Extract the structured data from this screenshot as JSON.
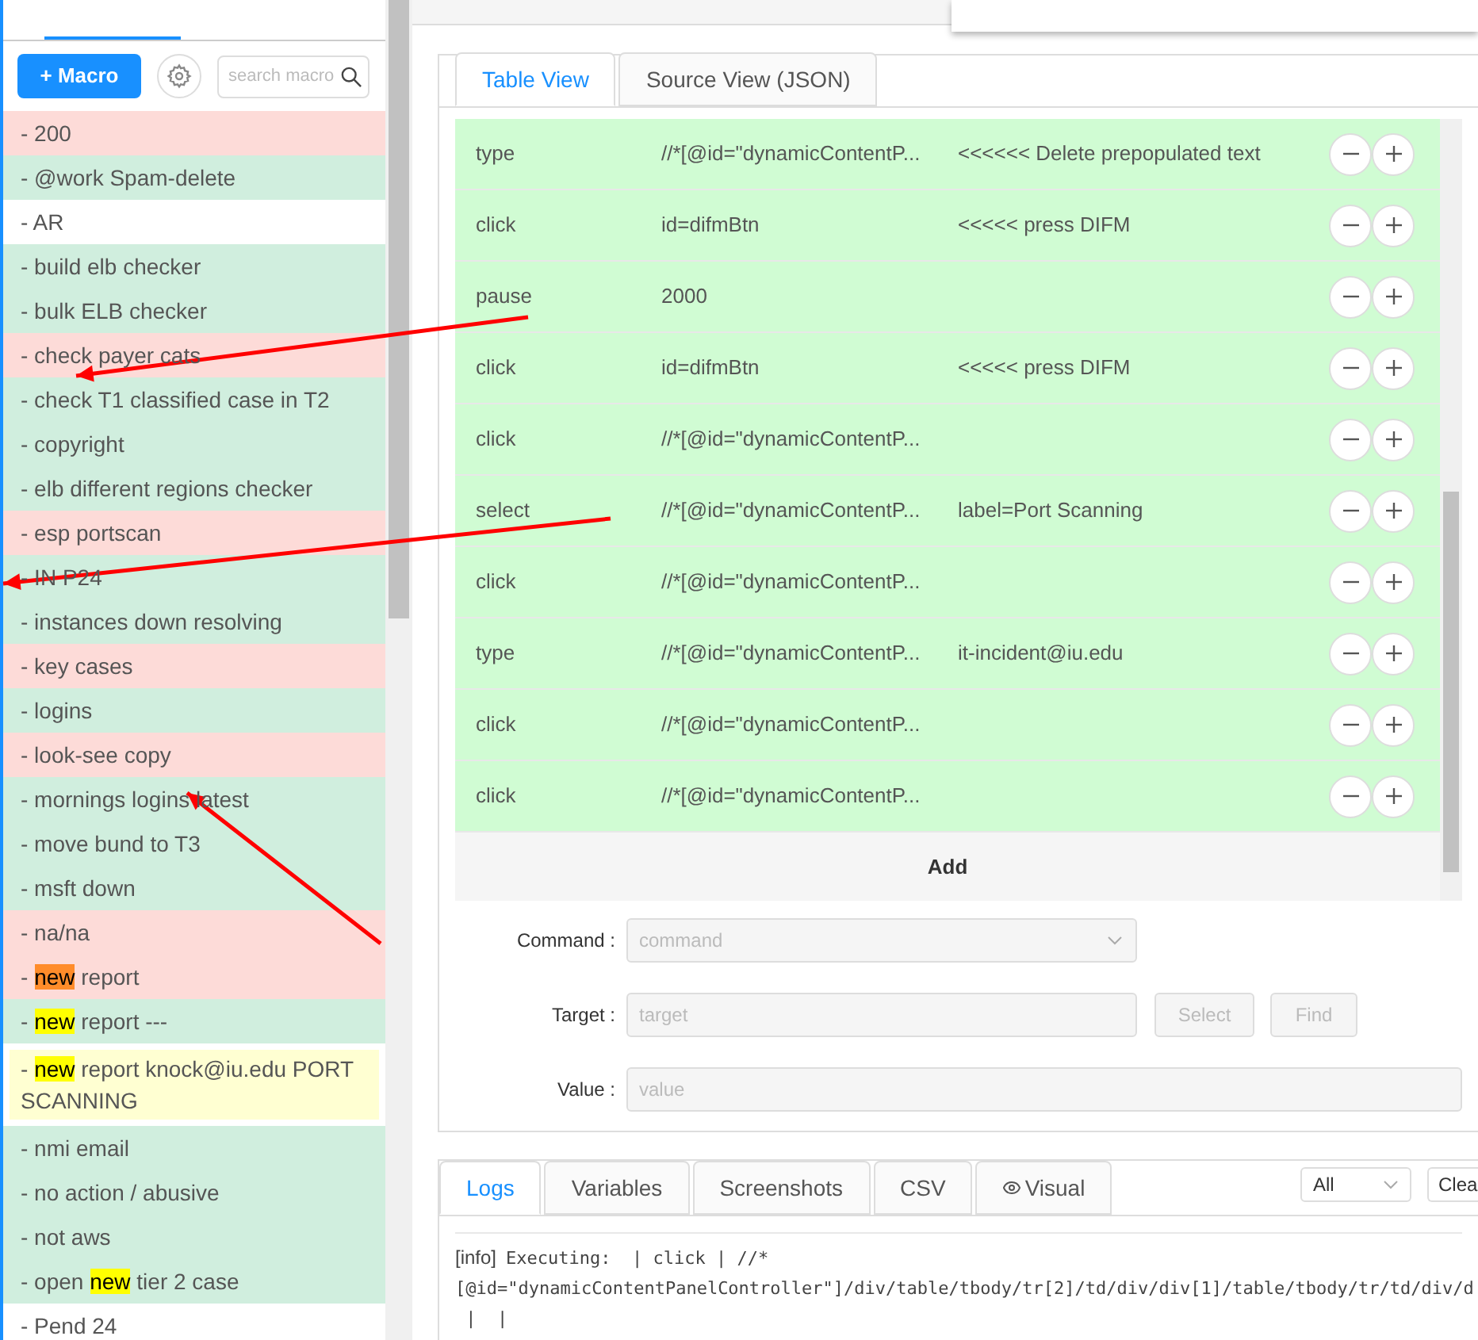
{
  "sidebar": {
    "new_macro_button": "+ Macro",
    "search": {
      "placeholder": "search macro"
    },
    "items": [
      {
        "text": "- 200",
        "color": "#fddbd8"
      },
      {
        "text": "- @work Spam-delete",
        "color": "#d0eede"
      },
      {
        "text": "- AR",
        "color": "#ffffff"
      },
      {
        "text": "- build elb checker",
        "color": "#d0eede"
      },
      {
        "text": "- bulk ELB checker",
        "color": "#d0eede"
      },
      {
        "text": "- check payer cats",
        "color": "#fddbd8"
      },
      {
        "text": "- check T1 classified case in T2",
        "color": "#d0eede"
      },
      {
        "text": "- copyright",
        "color": "#d0eede"
      },
      {
        "text": "- elb different regions checker",
        "color": "#d0eede"
      },
      {
        "text": "- esp portscan",
        "color": "#fddbd8"
      },
      {
        "text": "- IN P24",
        "color": "#d0eede"
      },
      {
        "text": "- instances down resolving",
        "color": "#d0eede"
      },
      {
        "text": "- key cases",
        "color": "#fddbd8"
      },
      {
        "text": "- logins",
        "color": "#d0eede"
      },
      {
        "text": "- look-see copy",
        "color": "#fddbd8"
      },
      {
        "text": "- mornings logins latest",
        "color": "#d0eede"
      },
      {
        "text": "- move bund to T3",
        "color": "#d0eede"
      },
      {
        "text": "- msft down",
        "color": "#d0eede"
      },
      {
        "text": "- na/na",
        "color": "#fddbd8"
      },
      {
        "text": "- ",
        "match": "new",
        "match_current": true,
        "rest": " report",
        "color": "#fddbd8"
      },
      {
        "text": "- ",
        "match": "new",
        "match_current": false,
        "rest": " report ---",
        "color": "#d0eede"
      },
      {
        "text": "- ",
        "match": "new",
        "match_current": false,
        "rest": " report knock@iu.edu PORT SCANNING",
        "color": "#ffffd2",
        "selected": true
      },
      {
        "text": "- nmi email",
        "color": "#d0eede"
      },
      {
        "text": "- no action / abusive",
        "color": "#d0eede"
      },
      {
        "text": "- not aws",
        "color": "#d0eede"
      },
      {
        "text": "- open ",
        "match": "new",
        "match_current": false,
        "rest": " tier 2 case",
        "color": "#d0eede"
      },
      {
        "text": "- Pend 24",
        "color": "#ffffff"
      }
    ]
  },
  "view_tabs": [
    {
      "label": "Table View",
      "selected": true
    },
    {
      "label": "Source View (JSON)",
      "selected": false
    }
  ],
  "commands": [
    {
      "command": "type",
      "target": "//*[@id=\"dynamicContentP...",
      "value": "<<<<<< Delete prepopulated text"
    },
    {
      "command": "click",
      "target": "id=difmBtn",
      "value": "<<<<< press DIFM"
    },
    {
      "command": "pause",
      "target": "2000"
    },
    {
      "command": "click",
      "target": "id=difmBtn",
      "value": "<<<<< press DIFM"
    },
    {
      "command": "click",
      "target": "//*[@id=\"dynamicContentP..."
    },
    {
      "command": "select",
      "target": "//*[@id=\"dynamicContentP...",
      "value": "label=Port Scanning"
    },
    {
      "command": "click",
      "target": "//*[@id=\"dynamicContentP..."
    },
    {
      "command": "type",
      "target": "//*[@id=\"dynamicContentP...",
      "value": "it-incident@iu.edu"
    },
    {
      "command": "click",
      "target": "//*[@id=\"dynamicContentP..."
    },
    {
      "command": "click",
      "target": "//*[@id=\"dynamicContentP..."
    }
  ],
  "add_button": "Add",
  "editor": {
    "command": {
      "label": "Command :",
      "placeholder": "command"
    },
    "target": {
      "label": "Target :",
      "placeholder": "target"
    },
    "value": {
      "label": "Value :",
      "placeholder": "value"
    },
    "select_button": "Select",
    "find_button": "Find"
  },
  "log_tabs": [
    {
      "label": "Logs",
      "selected": true
    },
    {
      "label": "Variables",
      "selected": false
    },
    {
      "label": "Screenshots",
      "selected": false
    },
    {
      "label": "CSV",
      "selected": false
    },
    {
      "label": "Visual",
      "selected": false,
      "kind": "with_icon"
    }
  ],
  "log_filter": "All",
  "clear_button": "Clea",
  "log": {
    "level": "[info]",
    "lines": [
      "Executing:  | click | //*",
      "[@id=\"dynamicContentPanelController\"]/div/table/tbody/tr[2]/td/div/div[1]/table/tbody/tr/td/div/d",
      " |  |"
    ]
  }
}
